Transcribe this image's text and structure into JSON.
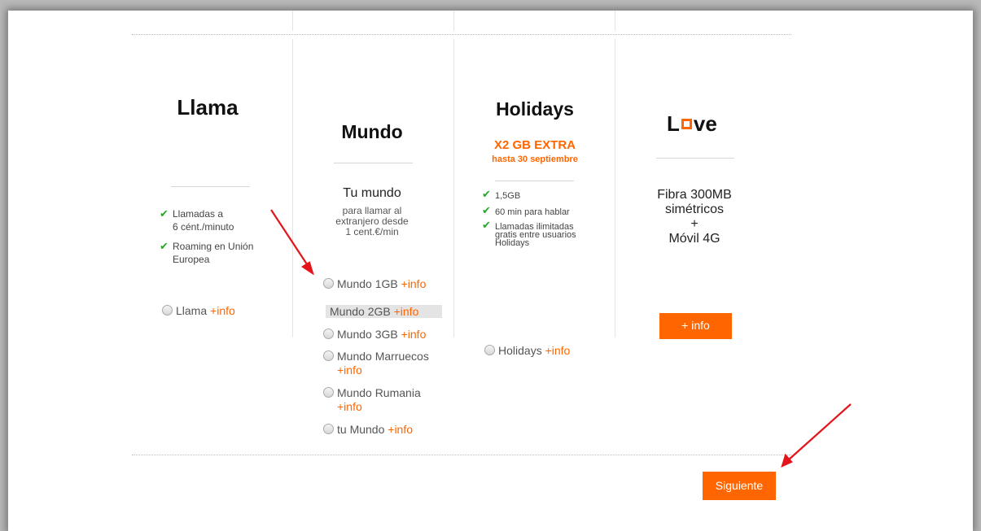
{
  "plans": {
    "llama": {
      "title": "Llama",
      "feature1": "Llamadas a\n6 cént./minuto",
      "feature2": "Roaming en Unión\nEuropea",
      "option_label": "Llama",
      "info_label": "+info"
    },
    "mundo": {
      "title": "Mundo",
      "subtitle": "Tu mundo",
      "description": "para llamar al\nextranjero desde\n1 cent.€/min",
      "options": [
        {
          "label": "Mundo 1GB",
          "info": "+info"
        },
        {
          "label": "Mundo 2GB",
          "info": "+info"
        },
        {
          "label": "Mundo 3GB",
          "info": "+info"
        },
        {
          "label": "Mundo Marruecos",
          "info": "+info"
        },
        {
          "label": "Mundo Rumania",
          "info": "+info"
        },
        {
          "label": "tu Mundo",
          "info": "+info"
        }
      ]
    },
    "holidays": {
      "title": "Holidays",
      "promo_line1": "X2 GB EXTRA",
      "promo_line2": "hasta 30 septiembre",
      "feature1": "1,5GB",
      "feature2": "60 min para hablar",
      "feature3": "Llamadas ilimitadas\ngratis entre usuarios\nHolidays",
      "option_label": "Holidays",
      "info_label": "+info"
    },
    "love": {
      "title_left": "L",
      "title_right": "ve",
      "description": "Fibra 300MB\nsimétricos\n+\nMóvil 4G",
      "button_label": "+ info"
    }
  },
  "footer": {
    "next_label": "Siguiente"
  },
  "colors": {
    "accent": "#ff6600",
    "check": "#2aa52a",
    "arrow": "#e3151a"
  },
  "icons": {
    "check": "check-icon",
    "radio": "radio-icon",
    "arrow": "red-arrow-icon"
  }
}
